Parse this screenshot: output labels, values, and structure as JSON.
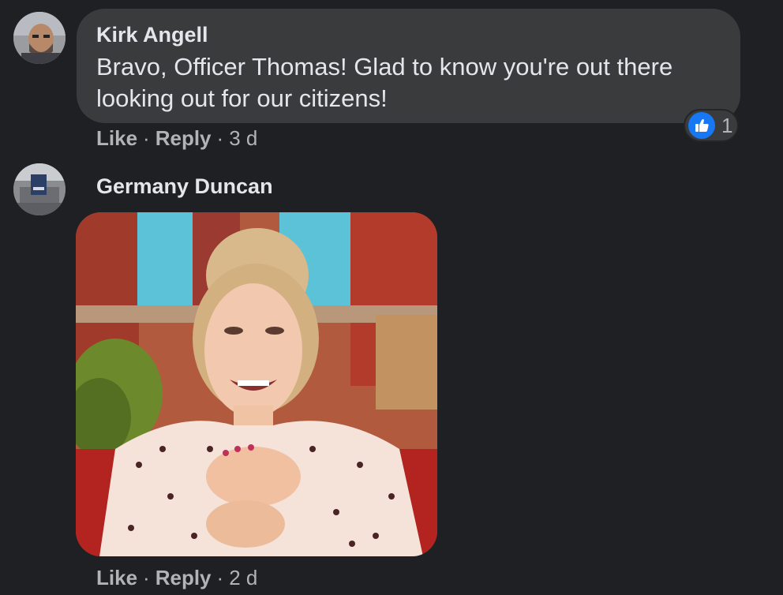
{
  "comments": [
    {
      "author": "Kirk Angell",
      "text": "Bravo, Officer Thomas! Glad to know you're out there looking out for our citizens!",
      "like_label": "Like",
      "reply_label": "Reply",
      "separator": "·",
      "time": "3 d",
      "reaction": {
        "icon": "thumbs-up-icon",
        "count": "1",
        "color": "#1877f2"
      }
    },
    {
      "author": "Germany Duncan",
      "attachment": "gif",
      "like_label": "Like",
      "reply_label": "Reply",
      "separator": "·",
      "time": "2 d"
    }
  ],
  "theme": {
    "background": "#1f2023",
    "bubble": "#3a3b3c",
    "text": "#e4e6eb",
    "secondary_text": "#b0b3b8"
  }
}
